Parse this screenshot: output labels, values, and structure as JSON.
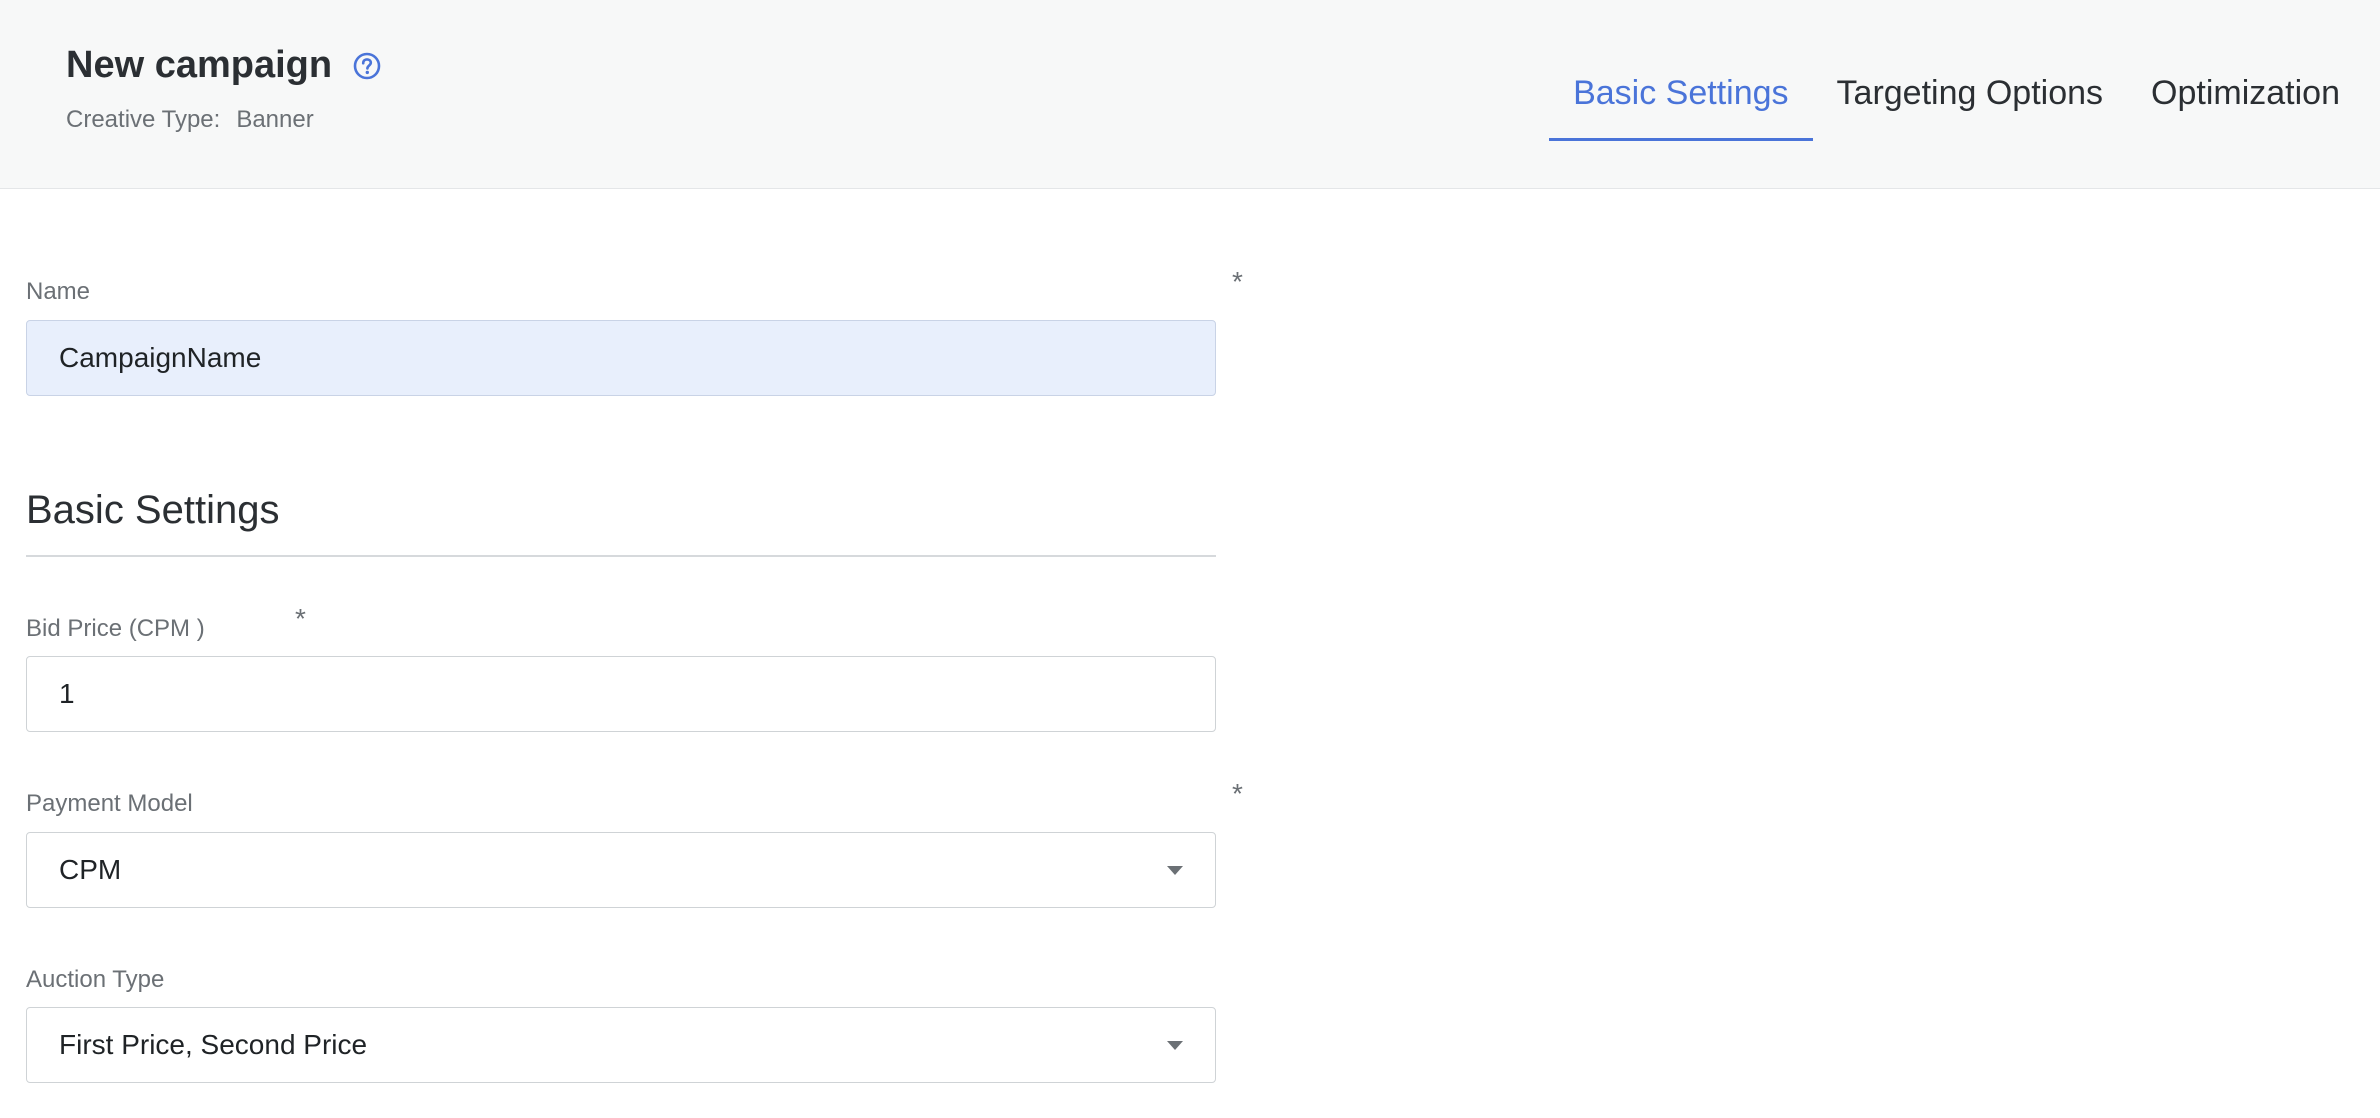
{
  "header": {
    "title": "New campaign",
    "creative_type_label": "Creative Type:",
    "creative_type_value": "Banner",
    "help_icon": "help-circle-icon",
    "tabs": [
      {
        "label": "Basic Settings",
        "active": true
      },
      {
        "label": "Targeting Options",
        "active": false
      },
      {
        "label": "Optimization",
        "active": false
      }
    ]
  },
  "form": {
    "name": {
      "label": "Name",
      "value": "CampaignName",
      "required_mark": "*"
    },
    "section_title": "Basic Settings",
    "bid_price": {
      "label": "Bid Price (CPM )",
      "value": "1",
      "required_mark": "*"
    },
    "payment_model": {
      "label": "Payment Model",
      "value": "CPM",
      "required_mark": "*"
    },
    "auction_type": {
      "label": "Auction Type",
      "value": "First Price, Second Price"
    }
  },
  "colors": {
    "accent": "#4a74d9",
    "header_bg": "#f7f8f8",
    "filled_input_bg": "#e8effc"
  }
}
